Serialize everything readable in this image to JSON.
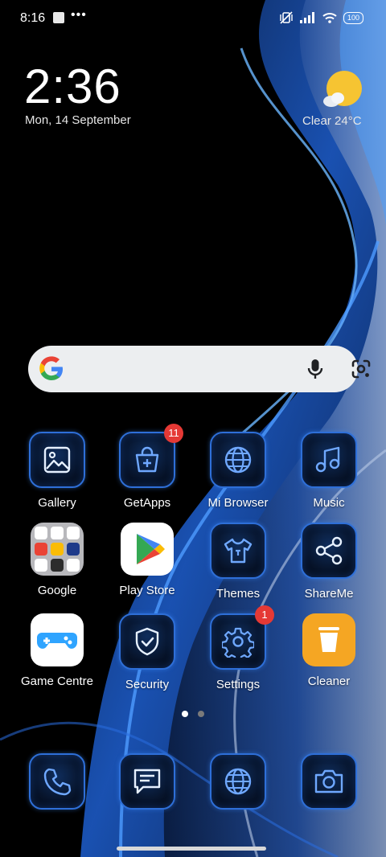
{
  "status_bar": {
    "time": "8:16",
    "dots": "•••",
    "battery": "100"
  },
  "widget": {
    "time": "2:36",
    "date": "Mon, 14 September",
    "weather": "Clear  24°C"
  },
  "apps": [
    {
      "label": "Gallery",
      "badge": ""
    },
    {
      "label": "GetApps",
      "badge": "11"
    },
    {
      "label": "Mi Browser",
      "badge": ""
    },
    {
      "label": "Music",
      "badge": ""
    },
    {
      "label": "Google",
      "badge": ""
    },
    {
      "label": "Play Store",
      "badge": ""
    },
    {
      "label": "Themes",
      "badge": ""
    },
    {
      "label": "ShareMe",
      "badge": ""
    },
    {
      "label": "Game Centre",
      "badge": ""
    },
    {
      "label": "Security",
      "badge": ""
    },
    {
      "label": "Settings",
      "badge": "1"
    },
    {
      "label": "Cleaner",
      "badge": ""
    }
  ],
  "dock": [
    "phone-icon",
    "messages-icon",
    "browser-icon",
    "camera-icon"
  ],
  "pagination": {
    "pages": 2,
    "current": 1
  },
  "colors": {
    "neon": "#2e6fd8",
    "badge": "#e53935",
    "cleaner": "#f5a623",
    "game": "#2fa4ff"
  }
}
